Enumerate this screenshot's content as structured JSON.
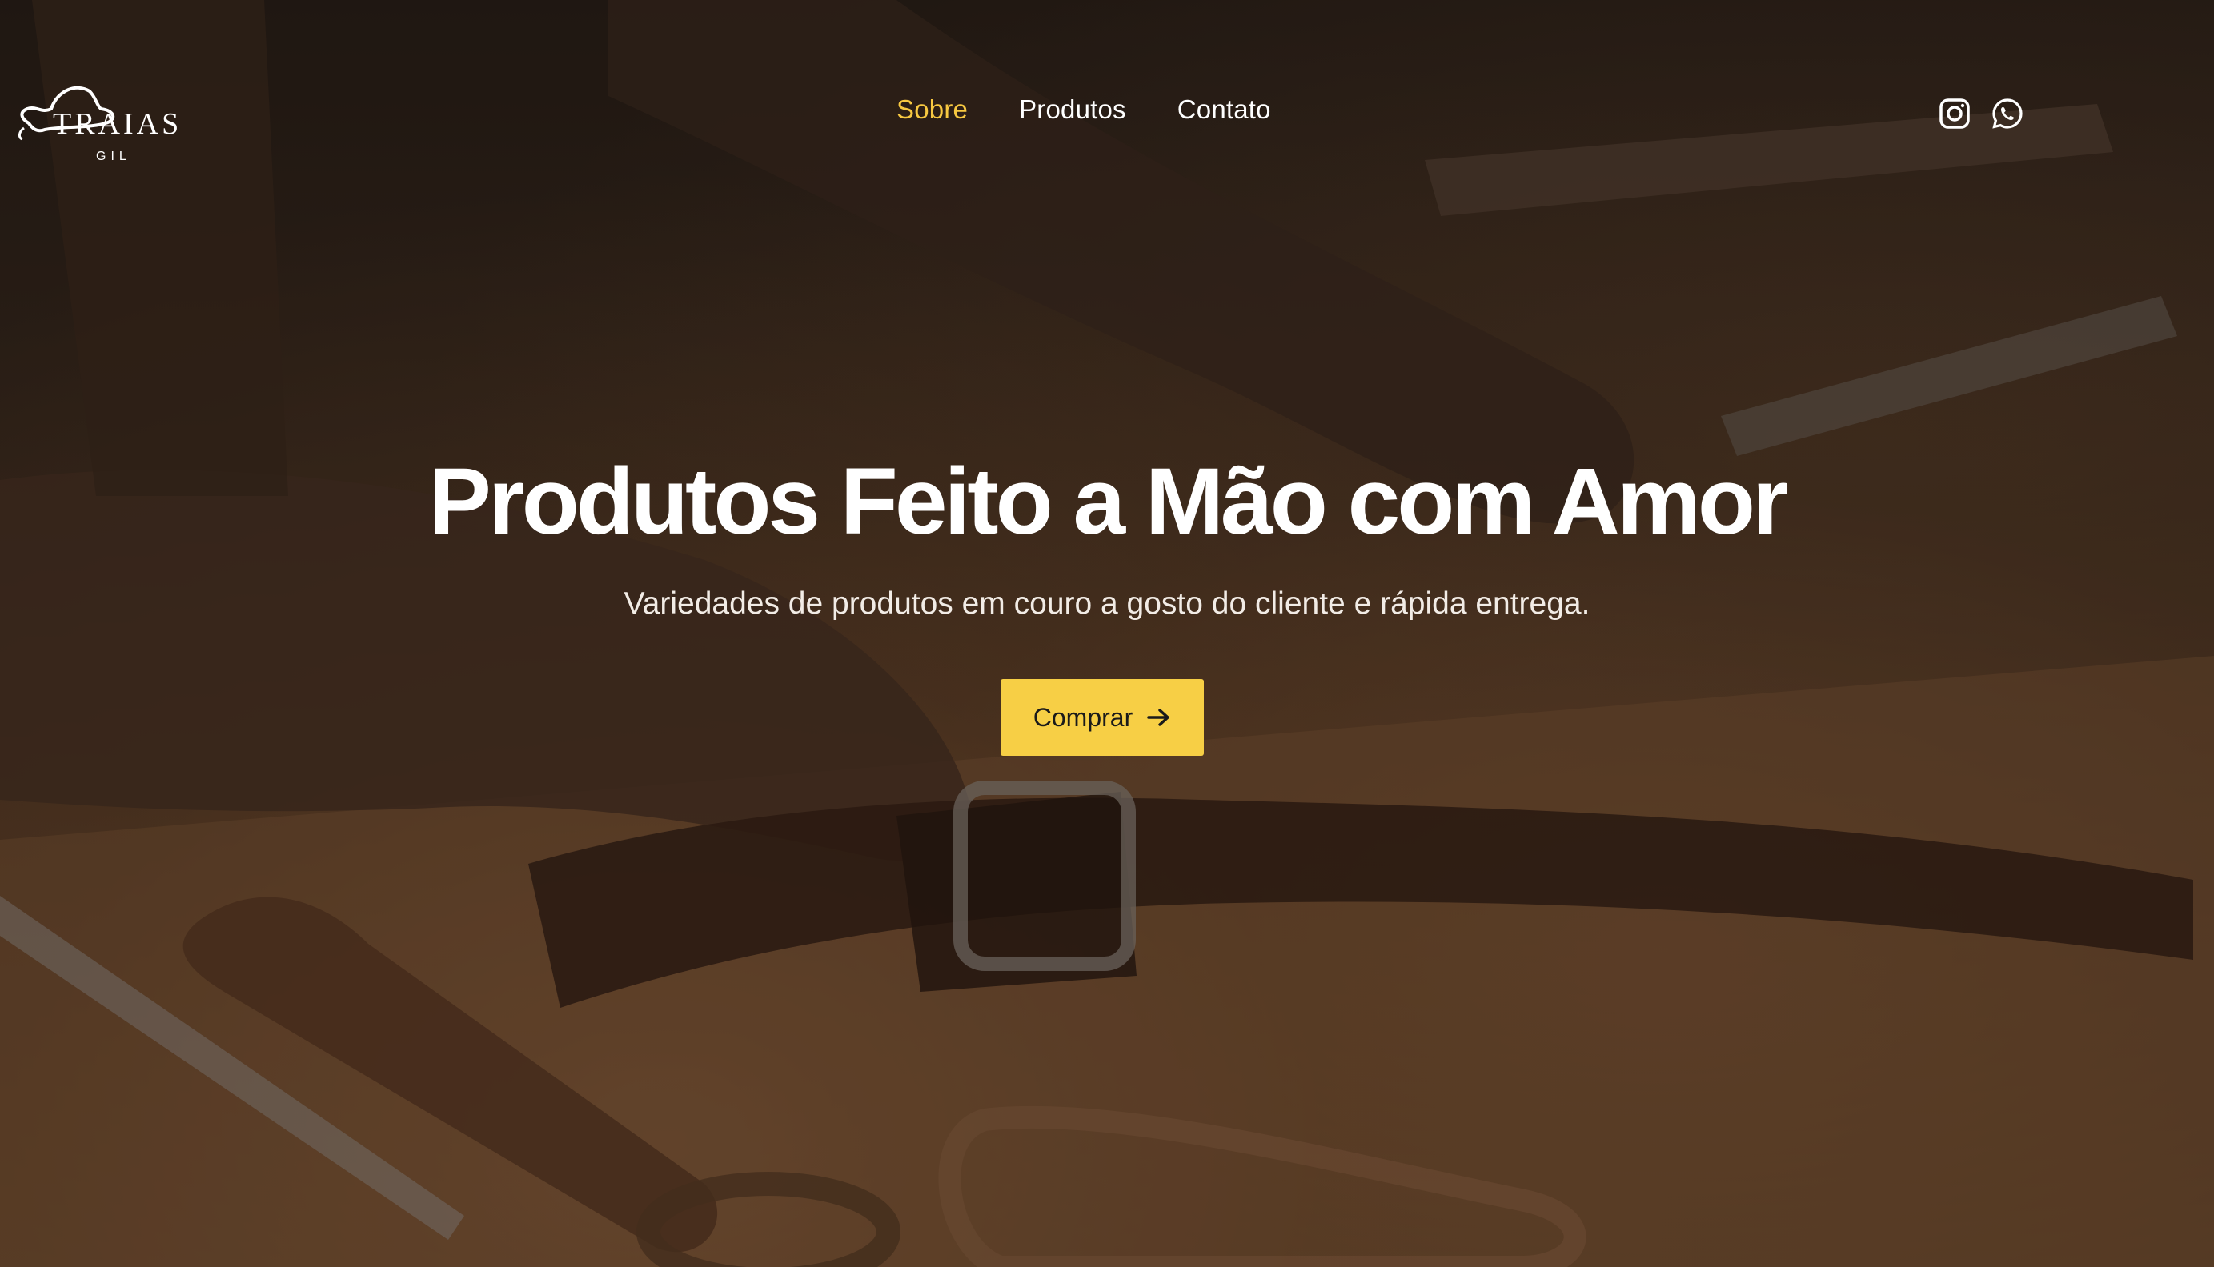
{
  "brand": {
    "logo_name": "TRAIAS",
    "logo_sub": "GIL"
  },
  "nav": {
    "items": [
      {
        "label": "Sobre",
        "active": true
      },
      {
        "label": "Produtos",
        "active": false
      },
      {
        "label": "Contato",
        "active": false
      }
    ]
  },
  "social": {
    "icons": [
      "instagram-icon",
      "whatsapp-icon"
    ]
  },
  "hero": {
    "title": "Produtos Feito a Mão com Amor",
    "subtitle": "Variedades de produtos em couro a gosto do cliente e rápida entrega.",
    "cta_label": "Comprar",
    "cta_icon": "arrow-right-icon"
  },
  "colors": {
    "accent": "#f7c841",
    "button": "#f7cf45",
    "text": "#ffffff"
  }
}
